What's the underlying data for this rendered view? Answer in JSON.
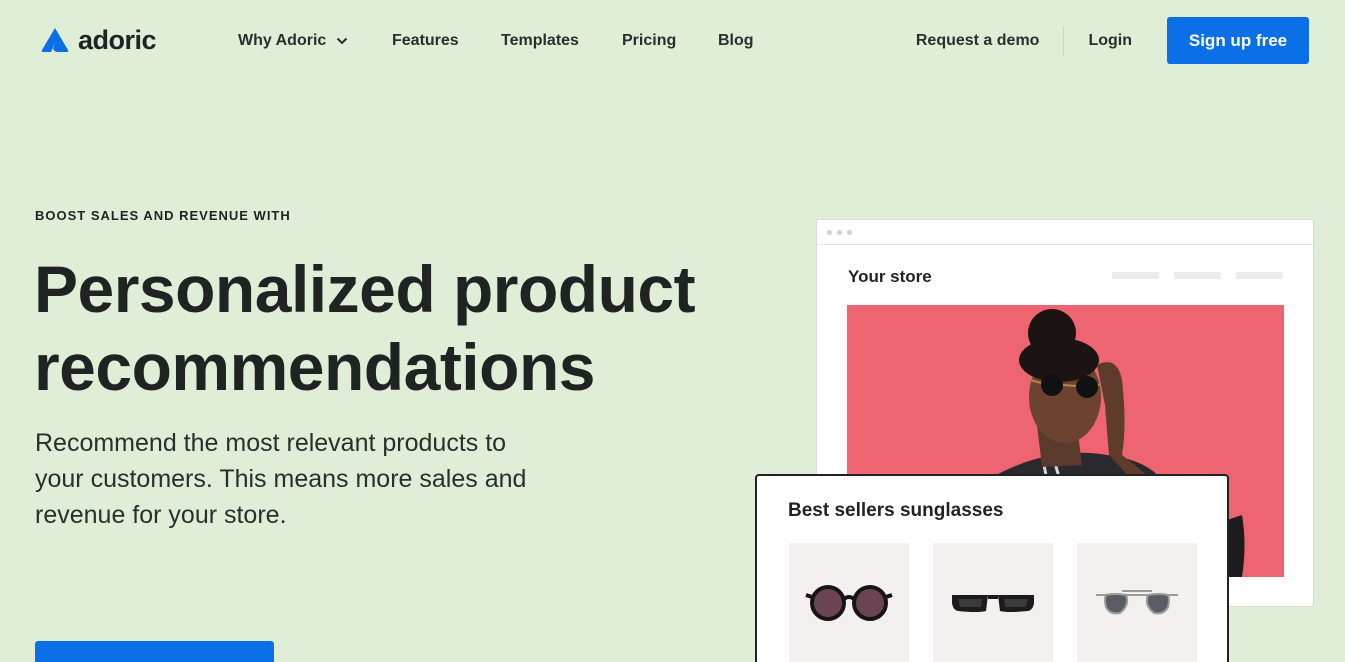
{
  "brand": {
    "name": "adoric",
    "accent": "#0b6fe8"
  },
  "nav": {
    "links": [
      {
        "label": "Why Adoric",
        "has_dropdown": true
      },
      {
        "label": "Features"
      },
      {
        "label": "Templates"
      },
      {
        "label": "Pricing"
      },
      {
        "label": "Blog"
      }
    ],
    "request_demo": "Request a demo",
    "login": "Login",
    "signup": "Sign up free"
  },
  "hero": {
    "eyebrow": "BOOST SALES AND REVENUE WITH",
    "headline": "Personalized product recommendations",
    "subtext": "Recommend the most relevant products to your customers. This means more sales and revenue for your store."
  },
  "mockup": {
    "store_title": "Your store",
    "card_title": "Best sellers sunglasses",
    "products": [
      "round-sunglasses",
      "rectangular-sunglasses",
      "aviator-sunglasses"
    ]
  },
  "colors": {
    "background": "#e1eed7",
    "button": "#0b6fe8",
    "hero_image_bg": "#ee6470"
  }
}
